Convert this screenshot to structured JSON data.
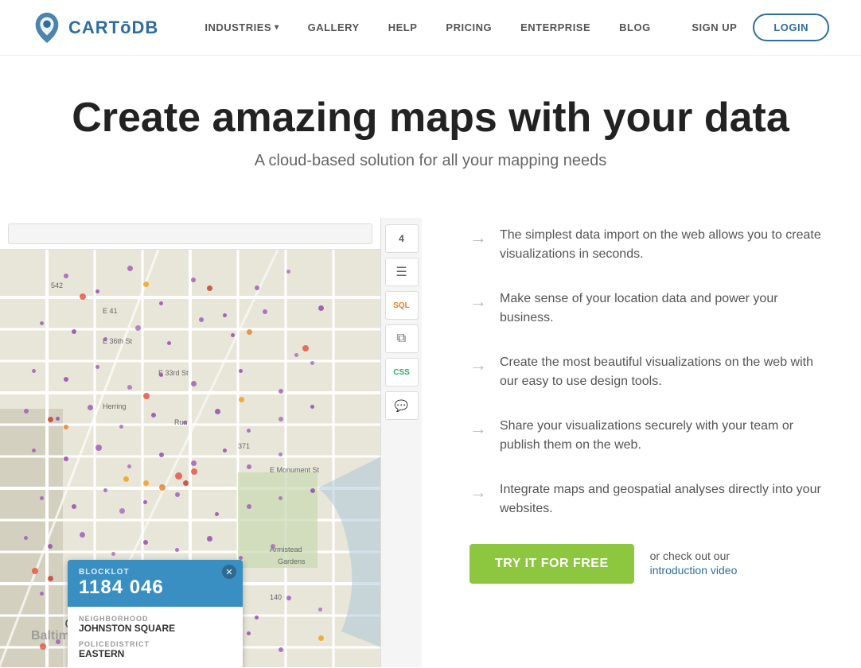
{
  "header": {
    "logo_text": "CARTōDB",
    "nav_items": [
      {
        "id": "industries",
        "label": "INDUSTRIES",
        "has_dropdown": true
      },
      {
        "id": "gallery",
        "label": "GALLERY",
        "has_dropdown": false
      },
      {
        "id": "help",
        "label": "HELP",
        "has_dropdown": false
      },
      {
        "id": "pricing",
        "label": "PRICING",
        "has_dropdown": false
      },
      {
        "id": "enterprise",
        "label": "ENTERPRISE",
        "has_dropdown": false
      },
      {
        "id": "blog",
        "label": "BLOG",
        "has_dropdown": false
      }
    ],
    "signup_label": "SIGN UP",
    "login_label": "LOGIN"
  },
  "hero": {
    "headline": "Create amazing maps with your data",
    "subheadline": "A cloud-based solution for all your mapping needs"
  },
  "features": [
    {
      "id": "feature-1",
      "text": "The simplest data import on the web allows you to create visualizations in seconds."
    },
    {
      "id": "feature-2",
      "text": "Make sense of your location data and power your business."
    },
    {
      "id": "feature-3",
      "text": "Create the most beautiful visualizations on the web with our easy to use design tools."
    },
    {
      "id": "feature-4",
      "text": "Share your visualizations securely with your team or publish them on the web."
    },
    {
      "id": "feature-5",
      "text": "Integrate maps and geospatial analyses directly into your websites."
    }
  ],
  "cta": {
    "try_button": "TRY IT FOR FREE",
    "or_text": "or check out our",
    "intro_link": "introduction video"
  },
  "map_popup": {
    "blocklot_label": "BLOCKLOT",
    "blocklot_value": "1184 046",
    "neighborhood_label": "NEIGHBORHOOD",
    "neighborhood_value": "JOHNSTON SQUARE",
    "policedistrict_label": "POLICEDISTRICT",
    "policedistrict_value": "EASTERN"
  },
  "toolbar": {
    "buttons": [
      "4",
      "≡",
      "SQL",
      "⧉",
      "CSS",
      "☒"
    ]
  },
  "colors": {
    "accent_blue": "#2d6e9e",
    "accent_green": "#8dc63f",
    "popup_blue": "#3a8fc2"
  }
}
